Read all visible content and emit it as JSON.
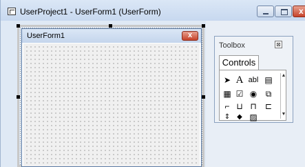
{
  "window": {
    "title": "UserProject1 - UserForm1 (UserForm)"
  },
  "userform": {
    "caption": "UserForm1"
  },
  "toolbox": {
    "title": "Toolbox",
    "close_glyph": "⊠",
    "tab": "Controls",
    "tools": [
      {
        "name": "select-objects-icon",
        "glyph": "➤"
      },
      {
        "name": "label-icon",
        "glyph": "A"
      },
      {
        "name": "textbox-icon",
        "glyph": "abl"
      },
      {
        "name": "combobox-icon",
        "glyph": "▤"
      },
      {
        "name": "listbox-icon",
        "glyph": "▦"
      },
      {
        "name": "checkbox-icon",
        "glyph": "☑"
      },
      {
        "name": "optionbutton-icon",
        "glyph": "◉"
      },
      {
        "name": "togglebutton-icon",
        "glyph": "⧉"
      },
      {
        "name": "frame-icon",
        "glyph": "⌐"
      },
      {
        "name": "commandbutton-icon",
        "glyph": "⊔"
      },
      {
        "name": "tabstrip-icon",
        "glyph": "⊓"
      },
      {
        "name": "multipage-icon",
        "glyph": "⊏"
      },
      {
        "name": "scrollbar-icon",
        "glyph": "⇕"
      },
      {
        "name": "spinbutton-icon",
        "glyph": "◆"
      },
      {
        "name": "image-icon",
        "glyph": "▨"
      }
    ]
  }
}
